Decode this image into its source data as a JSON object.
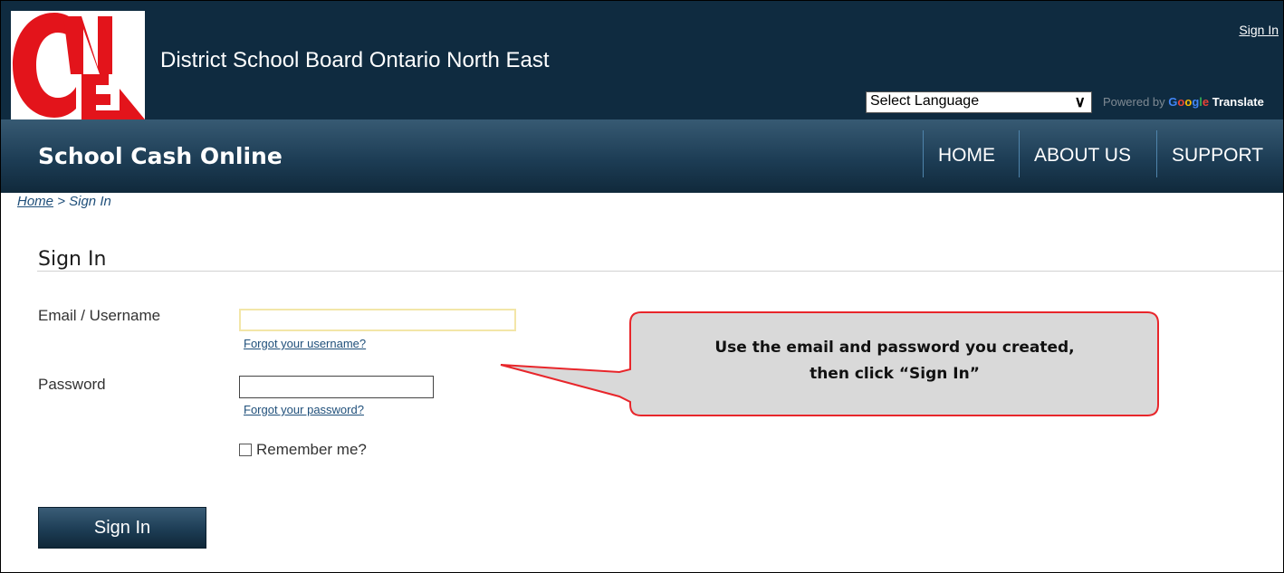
{
  "header": {
    "board_name": "District School Board Ontario North East",
    "sign_in_link": "Sign In",
    "language_select": "Select Language",
    "powered_by": "Powered by",
    "google_letters": [
      "G",
      "o",
      "o",
      "g",
      "l",
      "e"
    ],
    "translate": "Translate"
  },
  "nav": {
    "app_title": "School Cash Online",
    "links": [
      "HOME",
      "ABOUT US",
      "SUPPORT"
    ]
  },
  "breadcrumb": {
    "home": "Home",
    "separator": ">",
    "current": "Sign In"
  },
  "form": {
    "title": "Sign In",
    "email_label": "Email / Username",
    "email_value": "",
    "forgot_username": "Forgot your username?",
    "password_label": "Password",
    "password_value": "",
    "forgot_password": "Forgot your password?",
    "remember_label": "Remember me?",
    "remember_checked": false,
    "submit_label": "Sign In"
  },
  "callout": {
    "line1": "Use the email and password you created,",
    "line2": "then click “Sign In”"
  },
  "colors": {
    "header_bg": "#0f2b40",
    "nav_bg": "#1d3d55",
    "logo_red": "#e3141b",
    "link_blue": "#1f4f7a",
    "callout_fill": "#d9d9d9",
    "callout_border": "#e8262b"
  },
  "icons": {
    "logo": "one-logo",
    "dropdown": "chevron-down-icon",
    "checkbox": "checkbox-icon"
  }
}
